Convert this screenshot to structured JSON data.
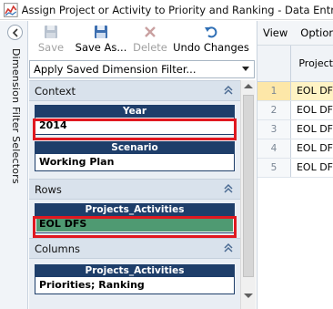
{
  "window": {
    "title": "Assign Project or Activity to Priority and Ranking - Data Entry"
  },
  "dimension_strip": {
    "label": "Dimension Filter Selectors"
  },
  "toolbar": {
    "save_label": "Save",
    "save_as_label": "Save As...",
    "delete_label": "Delete",
    "undo_label": "Undo Changes"
  },
  "filter": {
    "selected": "Apply Saved Dimension Filter..."
  },
  "panel": {
    "context": {
      "label": "Context",
      "year": {
        "title": "Year",
        "value": "2014"
      },
      "scenario": {
        "title": "Scenario",
        "value": "Working Plan"
      }
    },
    "rows": {
      "label": "Rows",
      "dim": {
        "title": "Projects_Activities",
        "value": "EOL DFS"
      }
    },
    "columns": {
      "label": "Columns",
      "dim": {
        "title": "Projects_Activities",
        "value": "Priorities; Ranking"
      }
    }
  },
  "grid": {
    "menu": [
      "View",
      "Option"
    ],
    "column_header": "Project",
    "rows": [
      {
        "num": "1",
        "value": "EOL DF"
      },
      {
        "num": "2",
        "value": "EOL DF"
      },
      {
        "num": "3",
        "value": "EOL DF"
      },
      {
        "num": "4",
        "value": "EOL DF"
      },
      {
        "num": "5",
        "value": "EOL DF"
      }
    ]
  },
  "colors": {
    "accent_navy": "#1e3e6a",
    "highlight_green": "#4f9a72",
    "outline_red": "#e01820",
    "selected_row": "#fff3c4"
  }
}
